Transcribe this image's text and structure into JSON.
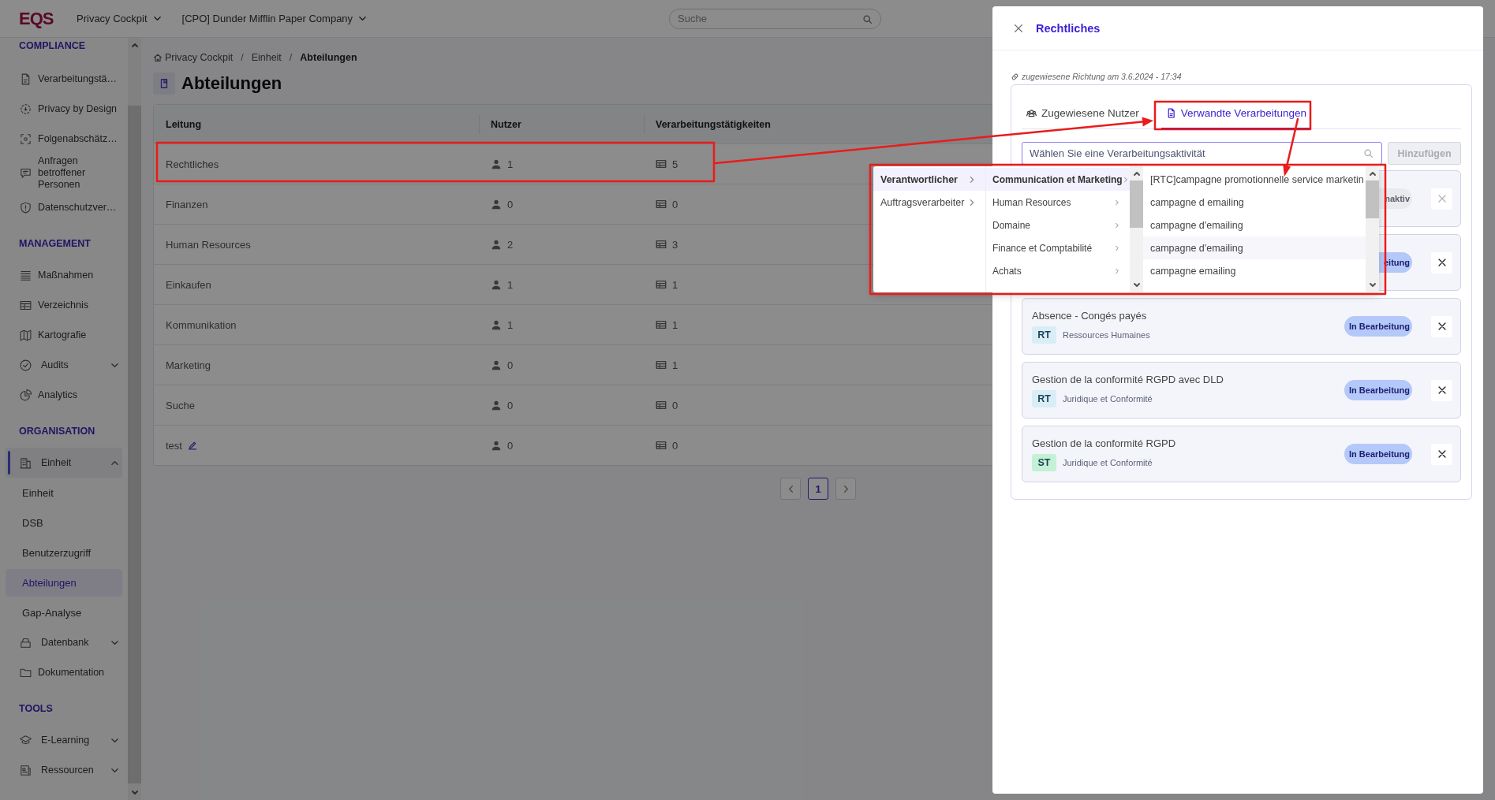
{
  "topbar": {
    "logo": "EQS",
    "module": "Privacy Cockpit",
    "company": "[CPO] Dunder Mifflin Paper Company",
    "search": {
      "placeholder": "Suche"
    }
  },
  "sidebar": {
    "sections": [
      {
        "title": "COMPLIANCE",
        "items": [
          {
            "label": "Verarbeitungstä…",
            "kind": "link",
            "selected": false
          },
          {
            "label": "Privacy by Design",
            "kind": "link",
            "selected": false
          },
          {
            "label": "Folgenabschätz…",
            "kind": "link",
            "selected": false
          },
          {
            "label": "Anfragen betroffener Personen",
            "kind": "link",
            "selected": false
          },
          {
            "label": "Datenschutzver…",
            "kind": "link",
            "selected": false
          }
        ]
      },
      {
        "title": "MANAGEMENT",
        "items": [
          {
            "label": "Maßnahmen",
            "kind": "link",
            "selected": false
          },
          {
            "label": "Verzeichnis",
            "kind": "link",
            "selected": false
          },
          {
            "label": "Kartografie",
            "kind": "link",
            "selected": false
          },
          {
            "label": "Audits",
            "kind": "group",
            "expanded": false,
            "selected": false
          },
          {
            "label": "Analytics",
            "kind": "link",
            "selected": false
          }
        ]
      },
      {
        "title": "ORGANISATION",
        "items": [
          {
            "label": "Einheit",
            "kind": "group",
            "expanded": true,
            "selected": false,
            "children": [
              {
                "label": "Einheit",
                "selected": false
              },
              {
                "label": "DSB",
                "selected": false
              },
              {
                "label": "Benutzerzugriff",
                "selected": false
              },
              {
                "label": "Abteilungen",
                "selected": true
              },
              {
                "label": "Gap-Analyse",
                "selected": false
              }
            ]
          },
          {
            "label": "Datenbank",
            "kind": "group",
            "expanded": false,
            "selected": false
          },
          {
            "label": "Dokumentation",
            "kind": "link",
            "selected": false
          }
        ]
      },
      {
        "title": "TOOLS",
        "items": [
          {
            "label": "E-Learning",
            "kind": "group",
            "expanded": false,
            "selected": false
          },
          {
            "label": "Ressourcen",
            "kind": "group",
            "expanded": false,
            "selected": false
          }
        ]
      }
    ]
  },
  "breadcrumb": {
    "separator": "/",
    "items": [
      "Privacy Cockpit",
      "Einheit",
      "Abteilungen"
    ]
  },
  "page_title": "Abteilungen",
  "table": {
    "columns": [
      "Leitung",
      "Nutzer",
      "Verarbeitungstätigkeiten"
    ],
    "rows": [
      {
        "name": "Rechtliches",
        "users": "1",
        "activities": "5",
        "editable": false
      },
      {
        "name": "Finanzen",
        "users": "0",
        "activities": "0",
        "editable": false
      },
      {
        "name": "Human Resources",
        "users": "2",
        "activities": "3",
        "editable": false
      },
      {
        "name": "Einkaufen",
        "users": "1",
        "activities": "1",
        "editable": false
      },
      {
        "name": "Kommunikation",
        "users": "1",
        "activities": "1",
        "editable": false
      },
      {
        "name": "Marketing",
        "users": "0",
        "activities": "1",
        "editable": false
      },
      {
        "name": "Suche",
        "users": "0",
        "activities": "0",
        "editable": false
      },
      {
        "name": "test",
        "users": "0",
        "activities": "0",
        "editable": true
      }
    ]
  },
  "pagination": {
    "pages": [
      {
        "label": "1",
        "selected": true
      }
    ]
  },
  "drawer": {
    "title": "Rechtliches",
    "meta": "zugewiesene Richtung am 3.6.2024 - 17:34",
    "tabs": [
      {
        "label": "Zugewiesene Nutzer",
        "selected": false
      },
      {
        "label": "Verwandte Verarbeitungen",
        "selected": true
      }
    ],
    "select": {
      "placeholder": "Wählen Sie eine Verarbeitungsaktivität",
      "dropdown": {
        "columns": [
          {
            "items": [
              {
                "label": "Verantwortlicher",
                "selected": true,
                "has_children": true
              },
              {
                "label": "Auftragsverarbeiter",
                "selected": false,
                "has_children": true
              }
            ]
          },
          {
            "items": [
              {
                "label": "Communication et Marketing",
                "selected": true,
                "has_children": true
              },
              {
                "label": "Human Resources",
                "selected": false,
                "has_children": true
              },
              {
                "label": "Domaine",
                "selected": false,
                "has_children": true
              },
              {
                "label": "Finance et Comptabilité",
                "selected": false,
                "has_children": true
              },
              {
                "label": "Achats",
                "selected": false,
                "has_children": true
              }
            ]
          },
          {
            "items": [
              {
                "label": "[RTC]campagne promotionnelle service marketin",
                "selected": false
              },
              {
                "label": "campagne d emailing",
                "selected": false
              },
              {
                "label": "campagne d'emailing",
                "selected": false
              },
              {
                "label": "campagne d'emailing",
                "selected": false,
                "highlighted": true
              },
              {
                "label": "campagne emailing",
                "selected": false
              }
            ]
          }
        ]
      }
    },
    "add_button": {
      "label": "Hinzufügen",
      "disabled": true
    },
    "items": [
      {
        "status": {
          "label": "naktiv",
          "kind": "inactive"
        },
        "remove_disabled": true
      },
      {
        "status": {
          "label": "eitung",
          "kind": "in_progress"
        },
        "remove_disabled": false
      },
      {
        "title": "Absence - Congés payés",
        "tag": {
          "text": "RT",
          "color": "#d9edf7"
        },
        "department": "Ressources Humaines",
        "status": {
          "label": "In Bearbeitung",
          "kind": "in_progress"
        },
        "remove_disabled": false
      },
      {
        "title": "Gestion de la conformité RGPD avec DLD",
        "tag": {
          "text": "RT",
          "color": "#d9edf7"
        },
        "department": "Juridique et Conformité",
        "status": {
          "label": "In Bearbeitung",
          "kind": "in_progress"
        },
        "remove_disabled": false
      },
      {
        "title": "Gestion de la conformité RGPD",
        "tag": {
          "text": "ST",
          "color": "#c4f1d5"
        },
        "department": "Juridique et Conformité",
        "status": {
          "label": "In Bearbeitung",
          "kind": "in_progress"
        },
        "remove_disabled": false
      }
    ]
  }
}
